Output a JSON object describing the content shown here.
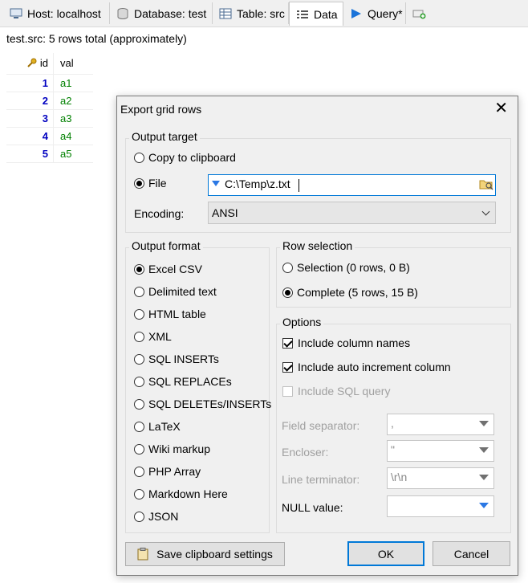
{
  "tabs": [
    {
      "label": "Host: localhost",
      "icon": "host-icon"
    },
    {
      "label": "Database: test",
      "icon": "database-icon"
    },
    {
      "label": "Table: src",
      "icon": "table-icon"
    },
    {
      "label": "Data",
      "icon": "data-grid-icon"
    },
    {
      "label": "Query*",
      "icon": "play-icon"
    },
    {
      "label": "",
      "icon": "new-query-tab-icon"
    }
  ],
  "status_text": "test.src: 5 rows total (approximately)",
  "grid": {
    "headers": [
      "id",
      "val"
    ],
    "rows": [
      {
        "id": "1",
        "val": "a1"
      },
      {
        "id": "2",
        "val": "a2"
      },
      {
        "id": "3",
        "val": "a3"
      },
      {
        "id": "4",
        "val": "a4"
      },
      {
        "id": "5",
        "val": "a5"
      }
    ]
  },
  "dialog": {
    "title": "Export grid rows",
    "output_target": {
      "title": "Output target",
      "copy_label": "Copy to clipboard",
      "file_label": "File",
      "file_value": "C:\\Temp\\z.txt",
      "selected": "file",
      "encoding_label": "Encoding:",
      "encoding_value": "ANSI"
    },
    "output_format": {
      "title": "Output format",
      "selected": 0,
      "options": [
        "Excel CSV",
        "Delimited text",
        "HTML table",
        "XML",
        "SQL INSERTs",
        "SQL REPLACEs",
        "SQL DELETEs/INSERTs",
        "LaTeX",
        "Wiki markup",
        "PHP Array",
        "Markdown Here",
        "JSON"
      ]
    },
    "row_selection": {
      "title": "Row selection",
      "selection_label": "Selection (0 rows, 0 B)",
      "complete_label": "Complete (5 rows, 15 B)",
      "selected": "complete"
    },
    "options": {
      "title": "Options",
      "include_column_names": "Include column names",
      "include_auto_increment": "Include auto increment column",
      "include_sql_query": "Include SQL query",
      "field_separator_label": "Field separator:",
      "field_separator_value": ",",
      "encloser_label": "Encloser:",
      "encloser_value": "\"",
      "line_terminator_label": "Line terminator:",
      "line_terminator_value": "\\r\\n",
      "null_value_label": "NULL value:",
      "null_value": ""
    },
    "buttons": {
      "save_clipboard": "Save clipboard settings",
      "ok": "OK",
      "cancel": "Cancel"
    }
  }
}
